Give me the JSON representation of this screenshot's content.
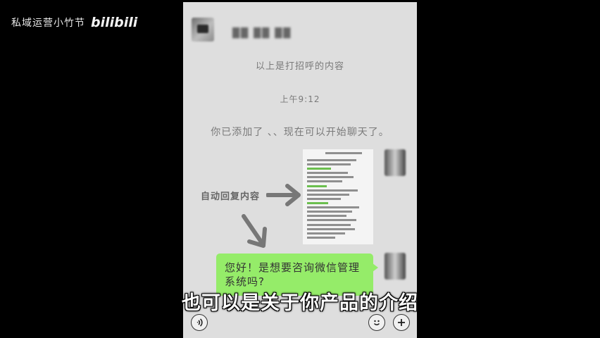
{
  "watermark": {
    "channel": "私域运营小竹节",
    "logo": "bilibili"
  },
  "chat": {
    "contact_name": "██ ██ ██",
    "greeting_notice": "以上是打招呼的内容",
    "timestamp": "上午9:12",
    "added_notice": "你已添加了 、、现在可以开始聊天了。",
    "auto_reply_label": "自动回复内容",
    "message_bubble": "您好！是想要咨询微信管理系统吗?"
  },
  "icons": {
    "voice": "voice-icon",
    "emoji": "emoji-icon",
    "plus": "plus-icon"
  },
  "subtitle": "也可以是关于你产品的介绍",
  "colors": {
    "bubble": "#95ec69",
    "chat_bg": "#dedede",
    "frame": "#000000"
  }
}
